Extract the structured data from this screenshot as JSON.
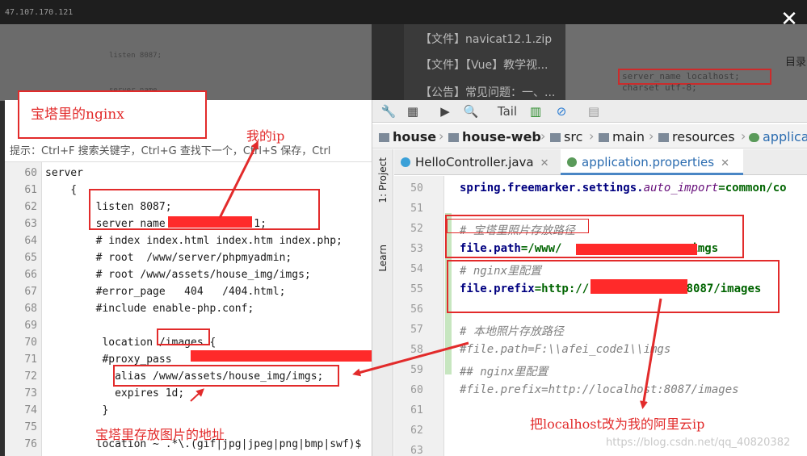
{
  "background": {
    "ip_text": "47.107.170.121",
    "files": [
      "【文件】navicat12.1.zip",
      "【文件】【Vue】教学视...",
      "【公告】常见问题：一、..."
    ],
    "side_label": "目录",
    "ghost_code_right": [
      "server_name  localhost;",
      "charset utf-8;"
    ],
    "ghost_code_left": [
      "listen 8087;",
      "server_name"
    ]
  },
  "left_panel": {
    "title": "宝塔里的nginx",
    "hint": "提示：Ctrl+F 搜索关键字，Ctrl+G 查找下一个，Ctrl+S 保存，Ctrl",
    "code_lines": [
      {
        "n": "60",
        "t": "server"
      },
      {
        "n": "61",
        "t": "    {"
      },
      {
        "n": "62",
        "t": "        listen 8087;"
      },
      {
        "n": "63",
        "t": "        server_name              1;"
      },
      {
        "n": "64",
        "t": "        # index index.html index.htm index.php;"
      },
      {
        "n": "65",
        "t": "        # root  /www/server/phpmyadmin;"
      },
      {
        "n": "66",
        "t": "        # root /www/assets/house_img/imgs;"
      },
      {
        "n": "67",
        "t": "        #error_page   404   /404.html;"
      },
      {
        "n": "68",
        "t": "        #include enable-php.conf;"
      },
      {
        "n": "69",
        "t": ""
      },
      {
        "n": "70",
        "t": "         location /images {"
      },
      {
        "n": "71",
        "t": "         #proxy_pass"
      },
      {
        "n": "72",
        "t": "           alias /www/assets/house_img/imgs;"
      },
      {
        "n": "73",
        "t": "           expires 1d;"
      },
      {
        "n": "74",
        "t": "         }"
      },
      {
        "n": "75",
        "t": ""
      },
      {
        "n": "76",
        "t": "        location ~ .*\\.(gif|jpg|jpeg|png|bmp|swf)$"
      }
    ]
  },
  "annotations": {
    "my_ip": "我的ip",
    "bt_img_path": "宝塔里存放图片的地址",
    "change_localhost": "把localhost改为我的阿里云ip"
  },
  "ide": {
    "toolbar": {
      "tail_label": "Tail"
    },
    "breadcrumb": [
      "house",
      "house-web",
      "src",
      "main",
      "resources",
      "applica"
    ],
    "sidebar": {
      "project_label": "1: Project",
      "learn_label": "Learn"
    },
    "tabs": [
      {
        "label": "HelloController.java",
        "active": false
      },
      {
        "label": "application.properties",
        "active": true
      }
    ],
    "lines": [
      {
        "n": "50",
        "key": "spring.freemarker.settings.",
        "ikey": "auto_import",
        "val": "=common/co"
      },
      {
        "n": "51",
        "comment": ""
      },
      {
        "n": "52",
        "comment": "# 宝塔里照片存放路径"
      },
      {
        "n": "53",
        "key": "file.path",
        "val": "=/www/",
        "tail": "imgs"
      },
      {
        "n": "54",
        "comment": "# nginx里配置"
      },
      {
        "n": "55",
        "key": "file.prefix",
        "val": "=http://",
        "tail": ":8087/images"
      },
      {
        "n": "56",
        "comment": ""
      },
      {
        "n": "57",
        "comment": "# 本地照片存放路径"
      },
      {
        "n": "58",
        "comment": "#file.path=F:\\\\afei_code1\\\\imgs"
      },
      {
        "n": "59",
        "comment": "## nginx里配置"
      },
      {
        "n": "60",
        "comment": "#file.prefix=http://localhost:8087/images"
      },
      {
        "n": "61",
        "comment": ""
      },
      {
        "n": "62",
        "comment": ""
      },
      {
        "n": "63",
        "comment": ""
      }
    ]
  },
  "watermark": "https://blog.csdn.net/qq_40820382",
  "colors": {
    "annotation_red": "#e22b2b",
    "redaction": "#ff2a2a",
    "ide_key": "#000080",
    "ide_value": "#006400"
  }
}
